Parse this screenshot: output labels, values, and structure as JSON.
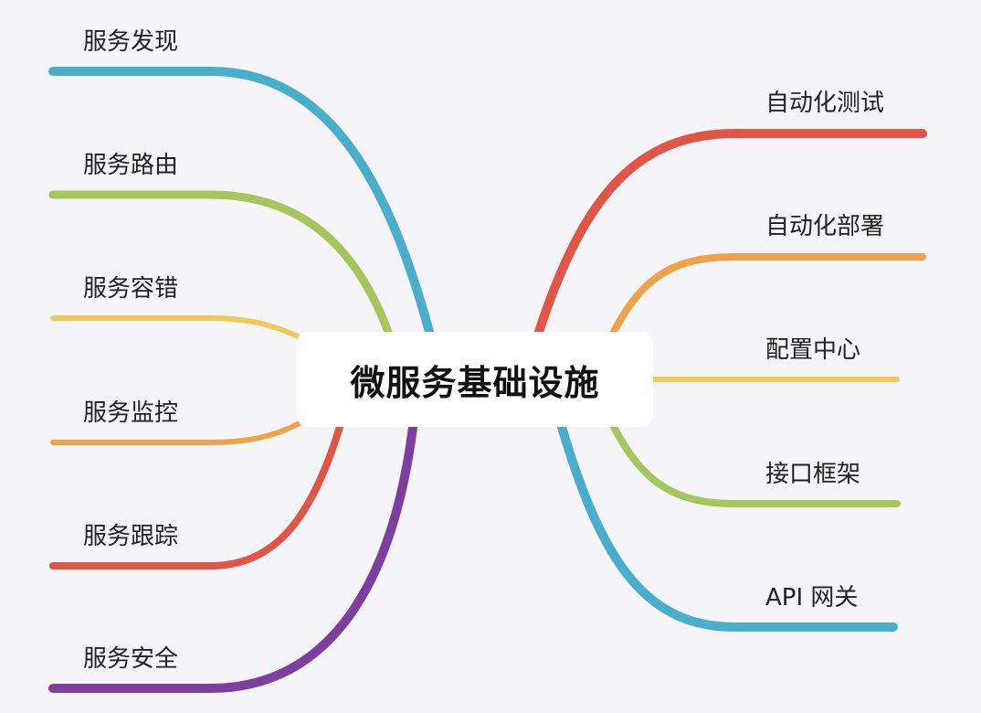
{
  "center": {
    "label": "微服务基础设施"
  },
  "left_branches": [
    {
      "label": "服务发现",
      "color": "#4aaecb"
    },
    {
      "label": "服务路由",
      "color": "#a6c55a"
    },
    {
      "label": "服务容错",
      "color": "#f1c95a"
    },
    {
      "label": "服务监控",
      "color": "#eea24a"
    },
    {
      "label": "服务跟踪",
      "color": "#e05545"
    },
    {
      "label": "服务安全",
      "color": "#7d3f9e"
    }
  ],
  "right_branches": [
    {
      "label": "自动化测试",
      "color": "#e05545"
    },
    {
      "label": "自动化部署",
      "color": "#eea24a"
    },
    {
      "label": "配置中心",
      "color": "#f1c95a"
    },
    {
      "label": "接口框架",
      "color": "#a6c55a"
    },
    {
      "label": "API 网关",
      "color": "#4aaecb"
    }
  ]
}
